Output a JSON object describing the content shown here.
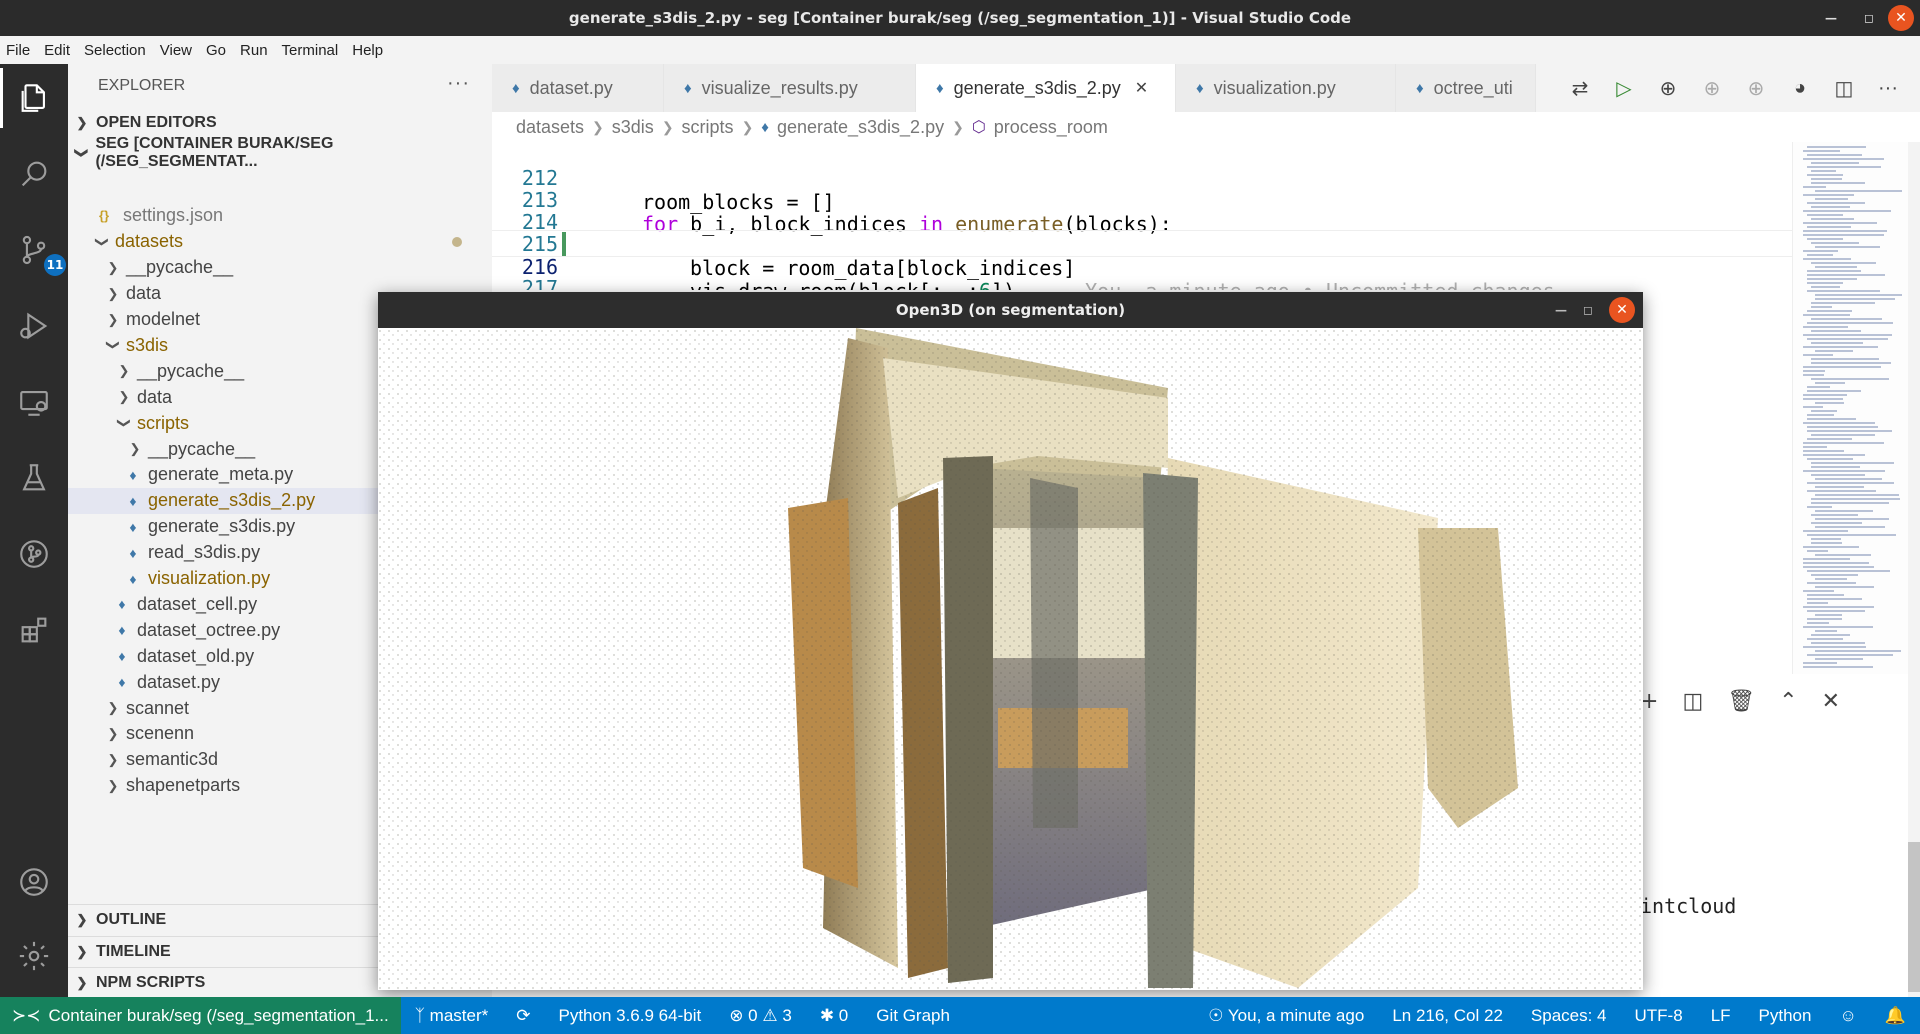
{
  "window": {
    "title": "generate_s3dis_2.py - seg [Container burak/seg (/seg_segmentation_1)] - Visual Studio Code"
  },
  "menu": [
    "File",
    "Edit",
    "Selection",
    "View",
    "Go",
    "Run",
    "Terminal",
    "Help"
  ],
  "activity_bar": {
    "scm_badge": "11"
  },
  "explorer": {
    "header": "EXPLORER",
    "open_editors": "OPEN EDITORS",
    "workspace": "SEG [CONTAINER BURAK/SEG (/SEG_SEGMENTAT...",
    "tree": [
      {
        "label": "settings.json",
        "type": "json"
      },
      {
        "label": "datasets",
        "type": "folder-open",
        "modified": true
      },
      {
        "label": "__pycache__",
        "type": "folder"
      },
      {
        "label": "data",
        "type": "folder"
      },
      {
        "label": "modelnet",
        "type": "folder"
      },
      {
        "label": "s3dis",
        "type": "folder-open",
        "modified": true
      },
      {
        "label": "__pycache__",
        "type": "folder"
      },
      {
        "label": "data",
        "type": "folder"
      },
      {
        "label": "scripts",
        "type": "folder-open",
        "modified": true
      },
      {
        "label": "__pycache__",
        "type": "folder"
      },
      {
        "label": "generate_meta.py",
        "type": "py"
      },
      {
        "label": "generate_s3dis_2.py",
        "type": "py",
        "modified": true,
        "selected": true
      },
      {
        "label": "generate_s3dis.py",
        "type": "py"
      },
      {
        "label": "read_s3dis.py",
        "type": "py"
      },
      {
        "label": "visualization.py",
        "type": "py",
        "modified": true
      },
      {
        "label": "dataset_cell.py",
        "type": "py"
      },
      {
        "label": "dataset_octree.py",
        "type": "py"
      },
      {
        "label": "dataset_old.py",
        "type": "py"
      },
      {
        "label": "dataset.py",
        "type": "py"
      },
      {
        "label": "scannet",
        "type": "folder"
      },
      {
        "label": "scenenn",
        "type": "folder"
      },
      {
        "label": "semantic3d",
        "type": "folder"
      },
      {
        "label": "shapenetparts",
        "type": "folder"
      }
    ],
    "sections": [
      "OUTLINE",
      "TIMELINE",
      "NPM SCRIPTS"
    ]
  },
  "tabs": [
    {
      "label": "dataset.py",
      "active": false
    },
    {
      "label": "visualize_results.py",
      "active": false
    },
    {
      "label": "generate_s3dis_2.py",
      "active": true
    },
    {
      "label": "visualization.py",
      "active": false
    },
    {
      "label": "octree_uti",
      "active": false
    }
  ],
  "breadcrumbs": [
    "datasets",
    "s3dis",
    "scripts",
    "generate_s3dis_2.py",
    "process_room"
  ],
  "code": {
    "lines": [
      {
        "n": "212",
        "text": "room_blocks = []"
      },
      {
        "n": "213",
        "text": "for b_i, block_indices in enumerate(blocks):"
      },
      {
        "n": "214",
        "text": ""
      },
      {
        "n": "215",
        "text": "block = room_data[block_indices]"
      },
      {
        "n": "216",
        "text": "vis.draw_room(block[:, :6])"
      },
      {
        "n": "217",
        "text": ""
      }
    ],
    "blame": "You, a minute ago • Uncommitted changes"
  },
  "open3d": {
    "title": "Open3D (on segmentation)"
  },
  "terminal": {
    "partial_text": "intcloud"
  },
  "status": {
    "remote": "Container burak/seg (/seg_segmentation_1...",
    "branch": "master*",
    "python": "Python 3.6.9 64-bit",
    "errors": "0",
    "warnings": "3",
    "ports": "0",
    "git_graph": "Git Graph",
    "blame": "You, a minute ago",
    "position": "Ln 216, Col 22",
    "spaces": "Spaces: 4",
    "encoding": "UTF-8",
    "eol": "LF",
    "language": "Python"
  },
  "colors": {
    "accent": "#007acc",
    "remote": "#16825d",
    "close": "#e95420"
  }
}
